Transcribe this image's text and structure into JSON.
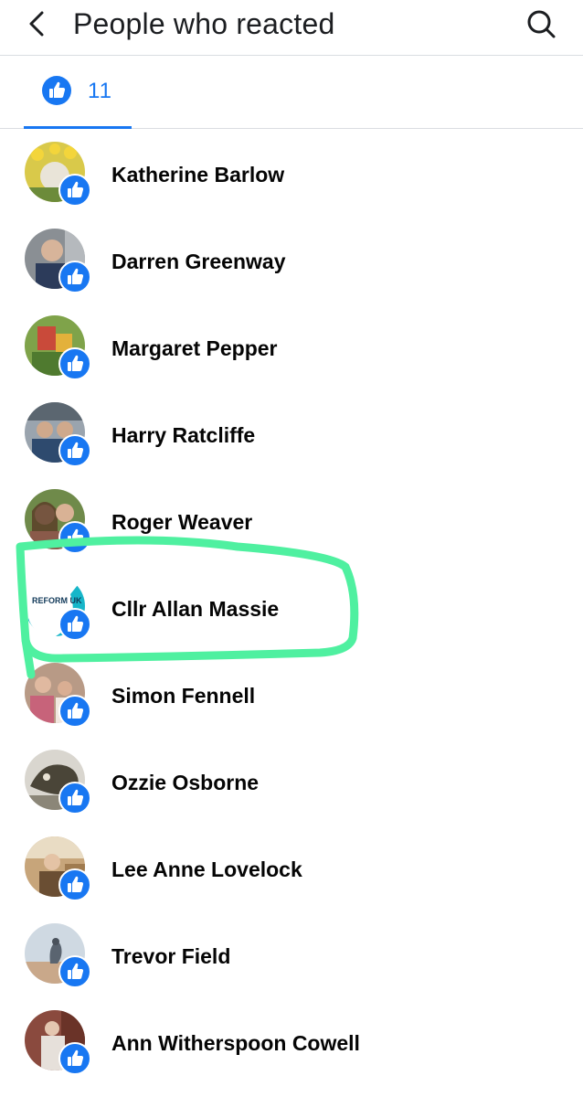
{
  "header": {
    "title": "People who reacted",
    "back_icon": "chevron-left-icon",
    "search_icon": "search-icon"
  },
  "tabs": [
    {
      "icon": "like-icon",
      "count": "11"
    }
  ],
  "reactors": [
    {
      "name": "Katherine Barlow"
    },
    {
      "name": "Darren Greenway"
    },
    {
      "name": "Margaret Pepper"
    },
    {
      "name": "Harry Ratcliffe"
    },
    {
      "name": "Roger Weaver"
    },
    {
      "name": "Cllr Allan Massie",
      "avatar_text": "REFORM UK"
    },
    {
      "name": "Simon Fennell"
    },
    {
      "name": "Ozzie Osborne"
    },
    {
      "name": "Lee Anne Lovelock"
    },
    {
      "name": "Trevor Field"
    },
    {
      "name": "Ann Witherspoon Cowell"
    }
  ],
  "colors": {
    "accent": "#1877f2",
    "highlight": "#4ff0a0",
    "text": "#050505",
    "divider": "#dadde1"
  }
}
